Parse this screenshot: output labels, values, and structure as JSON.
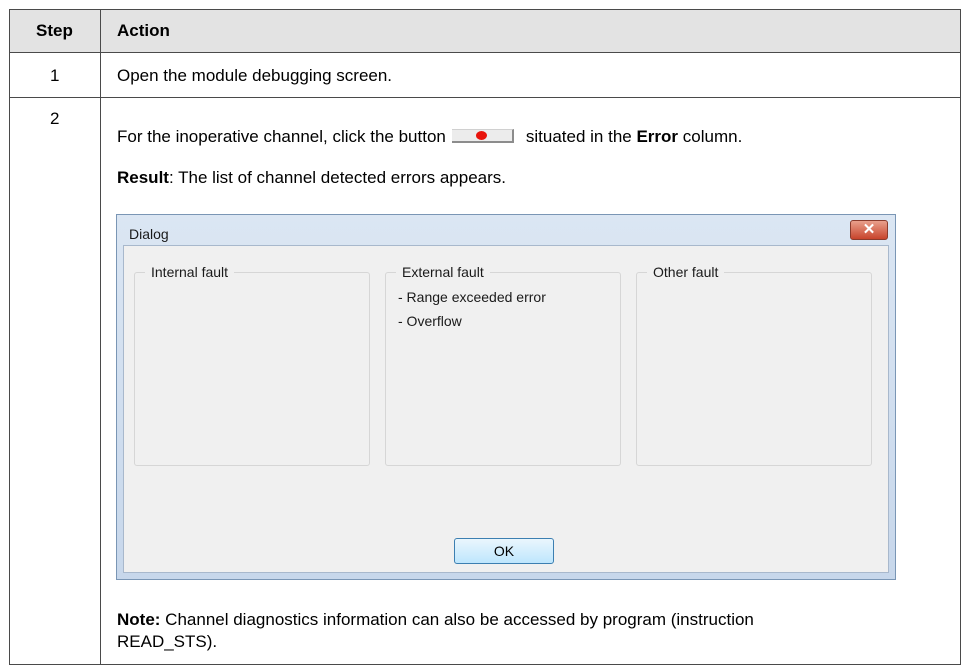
{
  "table": {
    "headers": {
      "step": "Step",
      "action": "Action"
    },
    "rows": [
      {
        "step": "1",
        "text": "Open the module debugging screen."
      },
      {
        "step": "2",
        "instruction": {
          "before": "For the inoperative channel, click the button",
          "after": "situated in the",
          "bold": "Error",
          "end": "column."
        },
        "result": {
          "label": "Result",
          "text": ": The list of channel detected errors appears."
        },
        "note": {
          "label": "Note:",
          "line1": " Channel diagnostics information can also be accessed by program (instruction",
          "line2": "READ_STS)."
        }
      }
    ]
  },
  "dialog": {
    "title": "Dialog",
    "close_label": "✕",
    "groups": [
      {
        "title": "Internal fault",
        "items": []
      },
      {
        "title": "External fault",
        "items": [
          "- Range exceeded error",
          "- Overflow"
        ]
      },
      {
        "title": "Other fault",
        "items": []
      }
    ],
    "ok_label": "OK"
  },
  "icons": {
    "error_button": "error-indicator-icon",
    "close": "close-icon"
  },
  "colors": {
    "header_bg": "#e3e3e3",
    "indicator_dot": "#e8140c",
    "dialog_frame": "#c7d7eb"
  }
}
